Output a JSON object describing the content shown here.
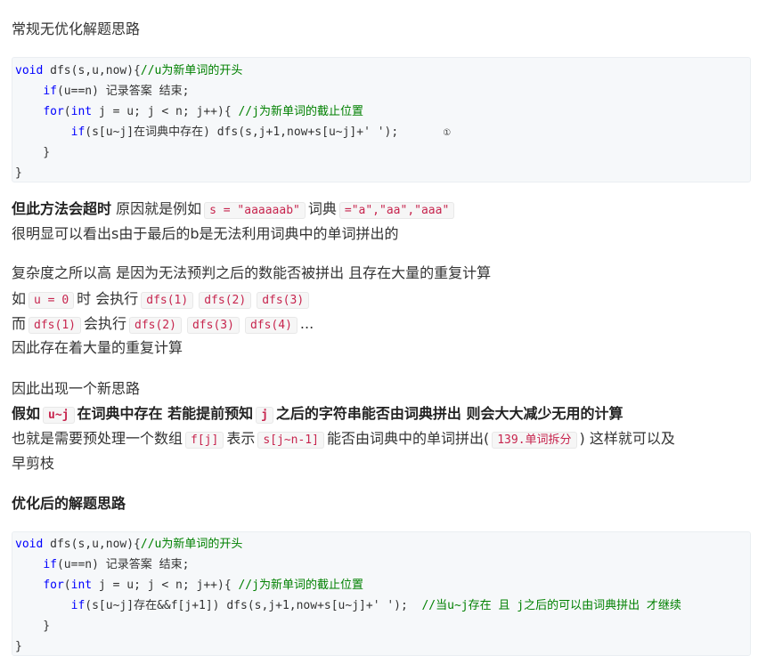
{
  "heading1": "常规无优化解题思路",
  "code1": {
    "l1_kw": "void",
    "l1_rest": " dfs(s,u,now){",
    "l1_cm": "//u为新单词的开头",
    "l2_ind": "    ",
    "l2_kw": "if",
    "l2_rest": "(u==n) 记录答案 结束;",
    "l3_ind": "    ",
    "l3_kw1": "for",
    "l3_p": "(",
    "l3_kw2": "int",
    "l3_rest": " j = u; j < n; j++){ ",
    "l3_cm": "//j为新单词的截止位置",
    "l4_ind": "        ",
    "l4_kw": "if",
    "l4_rest": "(s[u~j]在词典中存在) dfs(s,j+1,now+s[u~j]+' ');",
    "l4_mark": "①",
    "l5": "    }",
    "l6": "}"
  },
  "p1": {
    "bold": "但此方法会超时",
    "t1": " 原因就是例如",
    "c1": "s = \"aaaaaab\"",
    "t2": "词典",
    "c2": "=\"a\",\"aa\",\"aaa\"",
    "line2": "很明显可以看出s由于最后的b是无法利用词典中的单词拼出的"
  },
  "p2": {
    "line1": "复杂度之所以高 是因为无法预判之后的数能否被拼出 且存在大量的重复计算",
    "l2_t1": "如",
    "l2_c1": "u = 0",
    "l2_t2": "时 会执行",
    "l2_c2": "dfs(1)",
    "l2_c3": "dfs(2)",
    "l2_c4": "dfs(3)",
    "l3_t1": "而",
    "l3_c1": "dfs(1)",
    "l3_t2": "会执行",
    "l3_c2": "dfs(2)",
    "l3_c3": "dfs(3)",
    "l3_c4": "dfs(4)",
    "l3_t3": "...",
    "line4": "因此存在着大量的重复计算"
  },
  "p3": {
    "line1": "因此出现一个新思路",
    "b1": "假如",
    "c1": "u~j",
    "b2": "在词典中存在 若能提前预知",
    "c2": "j",
    "b3": "之后的字符串能否由词典拼出 则会大大减少无用的计算",
    "l3_t1": "也就是需要预处理一个数组",
    "l3_c1": "f[j]",
    "l3_t2": "表示",
    "l3_c2": "s[j~n-1]",
    "l3_t3": "能否由词典中的单词拼出(",
    "l3_c3": "139.单词拆分",
    "l3_t4": ") 这样就可以及",
    "line4": "早剪枝"
  },
  "heading2": "优化后的解题思路",
  "code2": {
    "l1_kw": "void",
    "l1_rest": " dfs(s,u,now){",
    "l1_cm": "//u为新单词的开头",
    "l2_ind": "    ",
    "l2_kw": "if",
    "l2_rest": "(u==n) 记录答案 结束;",
    "l3_ind": "    ",
    "l3_kw1": "for",
    "l3_p": "(",
    "l3_kw2": "int",
    "l3_rest": " j = u; j < n; j++){ ",
    "l3_cm": "//j为新单词的截止位置",
    "l4_ind": "        ",
    "l4_kw": "if",
    "l4_rest": "(s[u~j]存在&&f[j+1]) dfs(s,j+1,now+s[u~j]+' ');  ",
    "l4_cm": "//当u~j存在 且 j之后的可以由词典拼出 才继续",
    "l5": "    }",
    "l6": "}"
  }
}
